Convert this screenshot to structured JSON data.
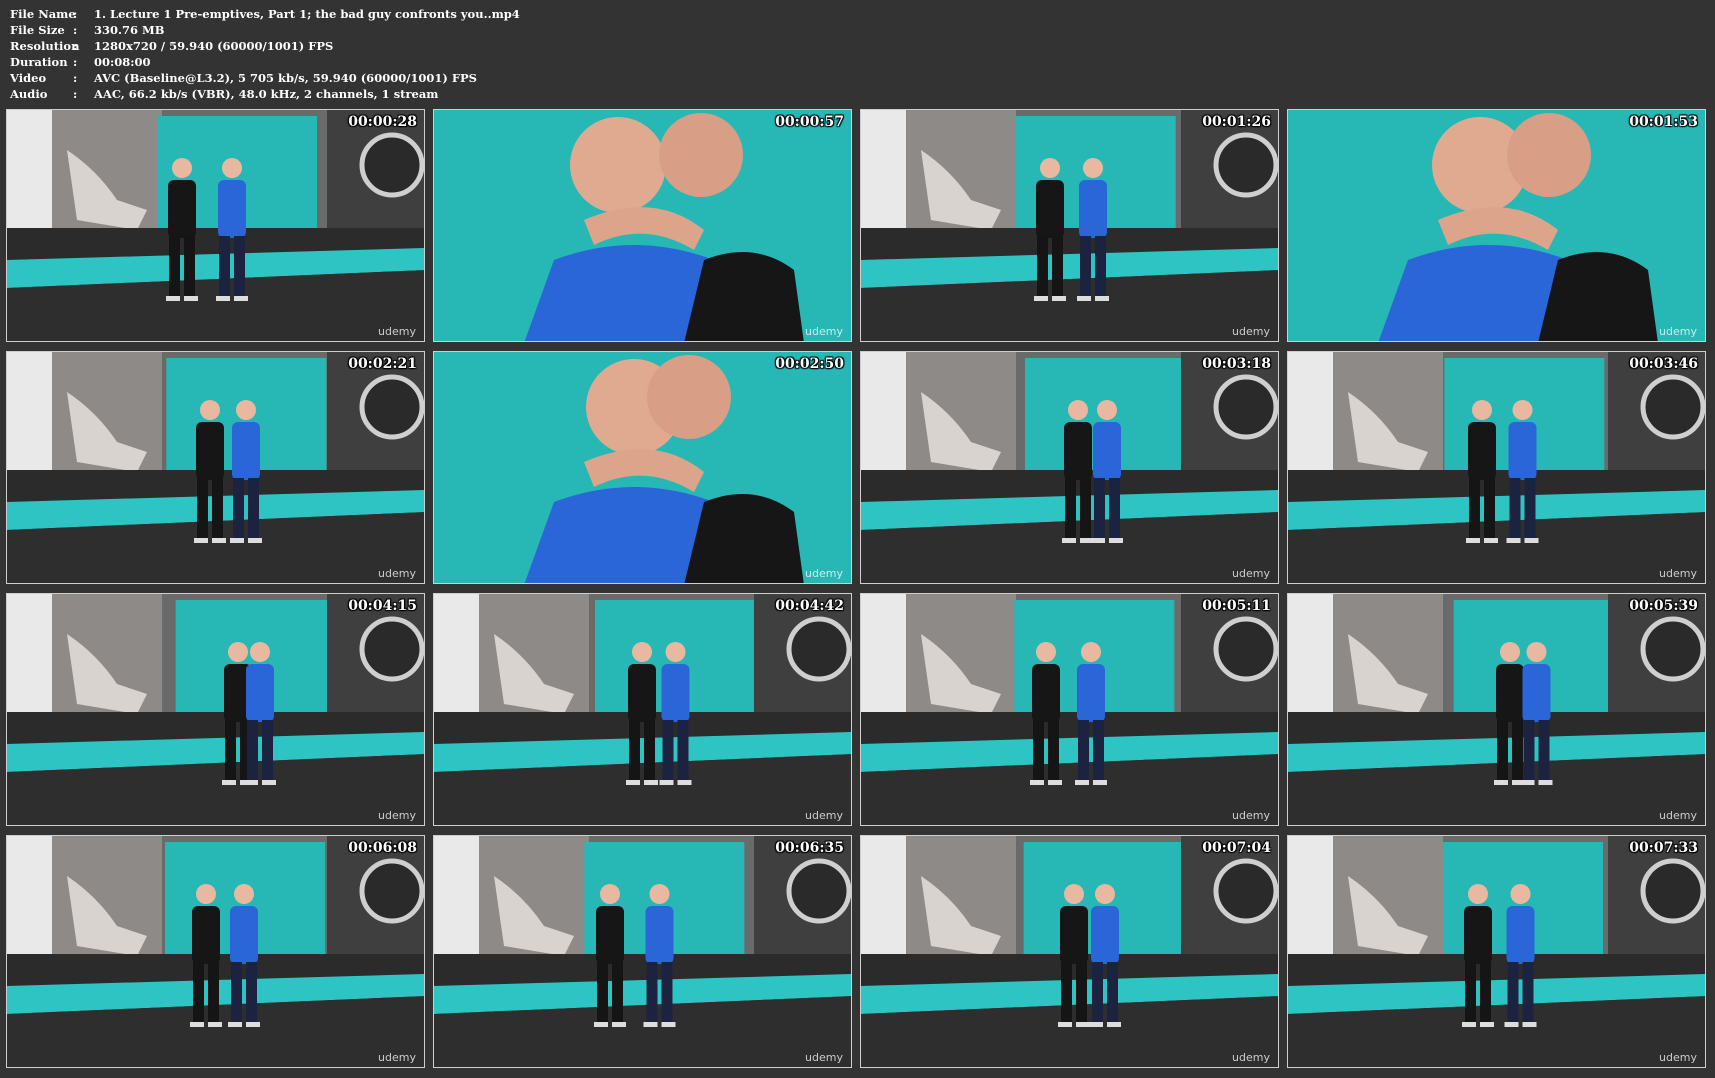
{
  "info": [
    {
      "key": "File Name",
      "sep": ":",
      "value": "1. Lecture 1 Pre-emptives, Part 1; the bad guy confronts you..mp4"
    },
    {
      "key": "File Size",
      "sep": ":",
      "value": "330.76 MB"
    },
    {
      "key": "Resolution",
      "sep": ":",
      "value": "1280x720 / 59.940 (60000/1001) FPS"
    },
    {
      "key": "Duration",
      "sep": ":",
      "value": "00:08:00"
    },
    {
      "key": "Video",
      "sep": ":",
      "value": "AVC (Baseline@L3.2), 5 705 kb/s, 59.940 (60000/1001) FPS"
    },
    {
      "key": "Audio",
      "sep": ":",
      "value": "AAC, 66.2 kb/s (VBR), 48.0 kHz, 2 channels, 1 stream"
    }
  ],
  "watermark": "udemy",
  "thumbnails": [
    {
      "time": "00:00:28",
      "scene": "wide"
    },
    {
      "time": "00:00:57",
      "scene": "close"
    },
    {
      "time": "00:01:26",
      "scene": "wide"
    },
    {
      "time": "00:01:53",
      "scene": "close"
    },
    {
      "time": "00:02:21",
      "scene": "wide"
    },
    {
      "time": "00:02:50",
      "scene": "close"
    },
    {
      "time": "00:03:18",
      "scene": "wide"
    },
    {
      "time": "00:03:46",
      "scene": "wide"
    },
    {
      "time": "00:04:15",
      "scene": "wide"
    },
    {
      "time": "00:04:42",
      "scene": "wide"
    },
    {
      "time": "00:05:11",
      "scene": "wide"
    },
    {
      "time": "00:05:39",
      "scene": "wide"
    },
    {
      "time": "00:06:08",
      "scene": "wide"
    },
    {
      "time": "00:06:35",
      "scene": "wide"
    },
    {
      "time": "00:07:04",
      "scene": "wide"
    },
    {
      "time": "00:07:33",
      "scene": "wide"
    }
  ],
  "colors": {
    "background": "#333333",
    "mat_teal": "#2fc4c4",
    "wall_teal": "#27b8b6",
    "floor": "#2b2b2b",
    "shirt_blue": "#2a66d8",
    "shirt_black": "#161616"
  }
}
